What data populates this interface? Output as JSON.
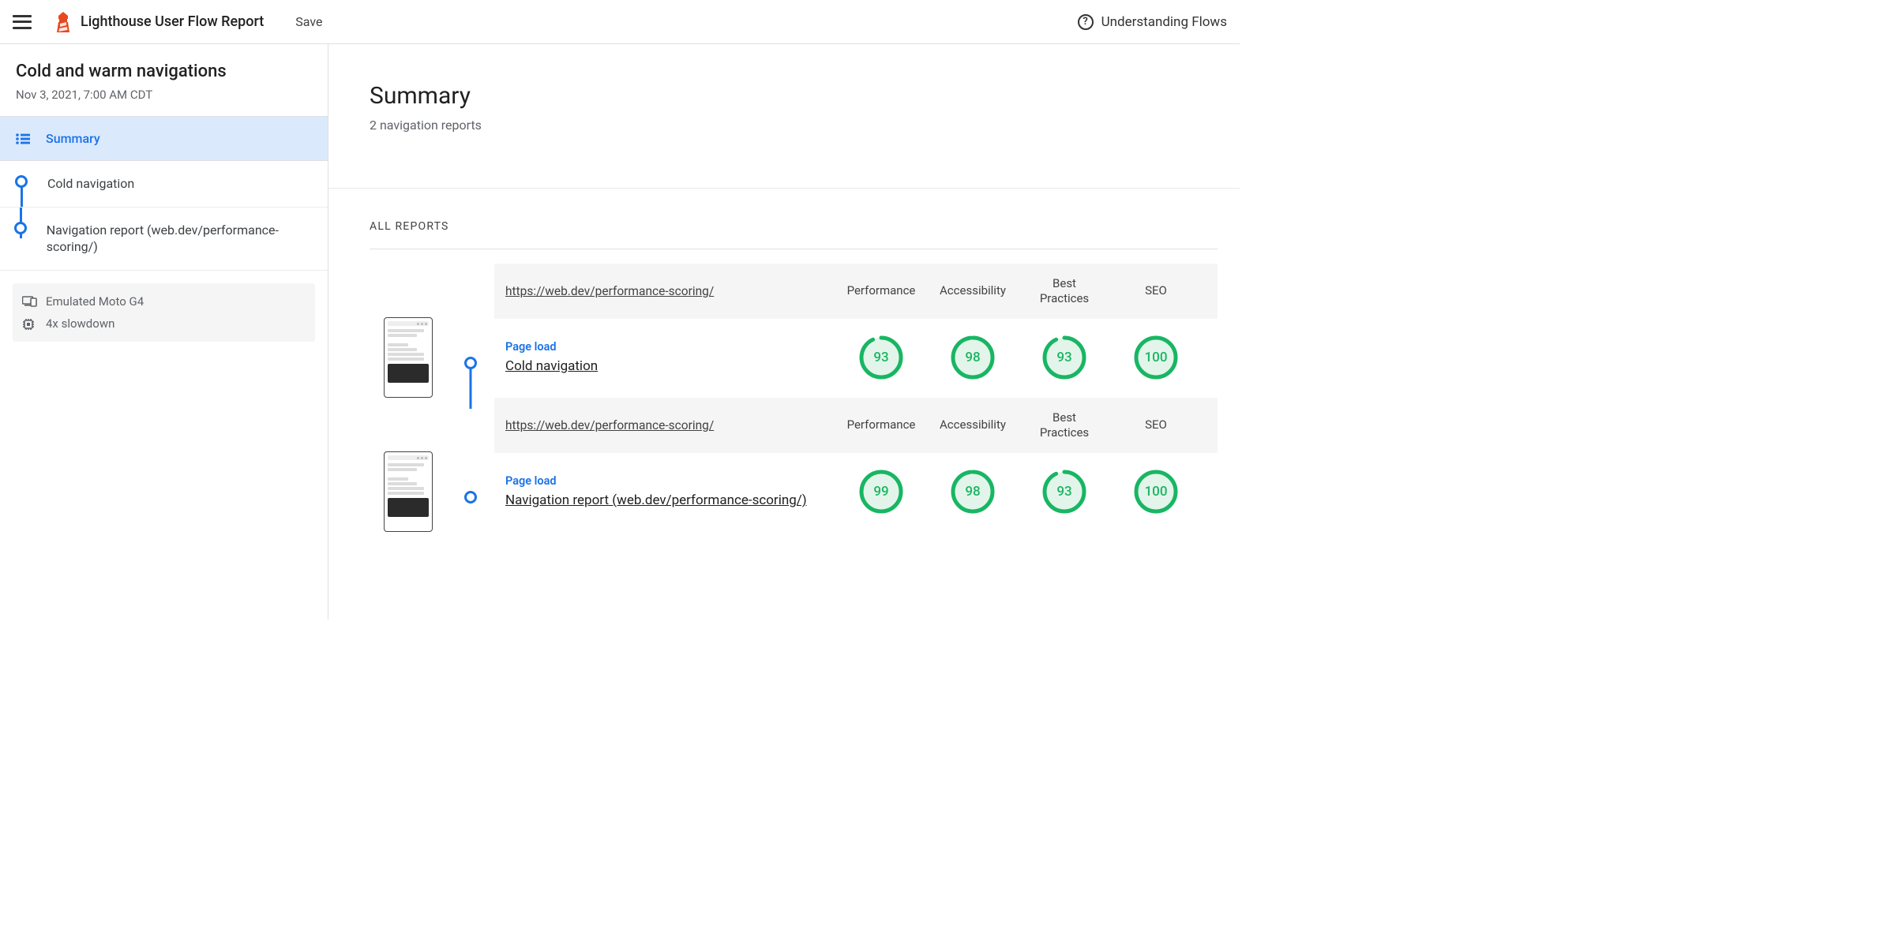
{
  "colors": {
    "accent": "#1a73e8",
    "good": "#18b663",
    "goodBg": "#e3f5ea"
  },
  "topbar": {
    "title": "Lighthouse User Flow Report",
    "save_label": "Save",
    "help_label": "Understanding Flows"
  },
  "sidebar": {
    "title": "Cold and warm navigations",
    "date": "Nov 3, 2021, 7:00 AM CDT",
    "summary_label": "Summary",
    "steps": [
      {
        "label": "Cold navigation"
      },
      {
        "label": "Navigation report (web.dev/performance-scoring/)"
      }
    ],
    "meta": {
      "device": "Emulated Moto G4",
      "throttle": "4x slowdown"
    }
  },
  "main": {
    "title": "Summary",
    "subtitle": "2 navigation reports",
    "all_reports_label": "ALL REPORTS",
    "categories": [
      "Performance",
      "Accessibility",
      "Best Practices",
      "SEO"
    ],
    "reports": [
      {
        "url": "https://web.dev/performance-scoring/",
        "kind": "Page load",
        "name": "Cold navigation",
        "scores": [
          93,
          98,
          93,
          100
        ]
      },
      {
        "url": "https://web.dev/performance-scoring/",
        "kind": "Page load",
        "name": "Navigation report (web.dev/performance-scoring/)",
        "scores": [
          99,
          98,
          93,
          100
        ]
      }
    ]
  }
}
